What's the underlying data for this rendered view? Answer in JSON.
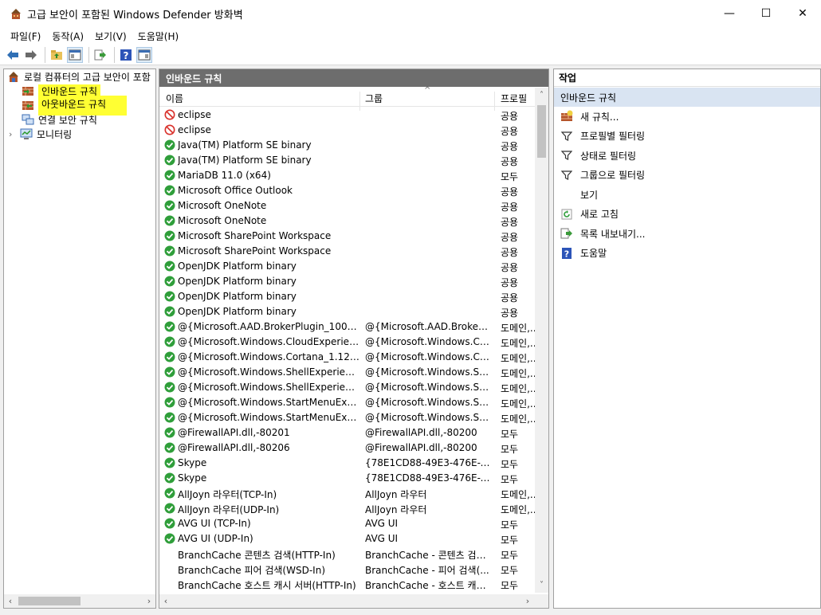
{
  "window": {
    "title": "고급 보안이 포함된 Windows Defender 방화벽",
    "minimize": "—",
    "maximize": "☐",
    "close": "✕"
  },
  "menu": [
    "파일(F)",
    "동작(A)",
    "보기(V)",
    "도움말(H)"
  ],
  "tree": {
    "root": "로컬 컴퓨터의 고급 보안이 포함",
    "items": [
      "인바운드 규칙",
      "아웃바운드 규칙",
      "연결 보안 규칙",
      "모니터링"
    ]
  },
  "center": {
    "title": "인바운드 규칙",
    "columns": {
      "name": "이름",
      "group": "그룹",
      "profile": "프로필"
    },
    "rows": [
      {
        "icon": "blocked",
        "name": "eclipse",
        "group": "",
        "profile": "공용"
      },
      {
        "icon": "blocked",
        "name": "eclipse",
        "group": "",
        "profile": "공용"
      },
      {
        "icon": "allowed",
        "name": "Java(TM) Platform SE binary",
        "group": "",
        "profile": "공용"
      },
      {
        "icon": "allowed",
        "name": "Java(TM) Platform SE binary",
        "group": "",
        "profile": "공용"
      },
      {
        "icon": "allowed",
        "name": "MariaDB 11.0 (x64)",
        "group": "",
        "profile": "모두"
      },
      {
        "icon": "allowed",
        "name": "Microsoft Office Outlook",
        "group": "",
        "profile": "공용"
      },
      {
        "icon": "allowed",
        "name": "Microsoft OneNote",
        "group": "",
        "profile": "공용"
      },
      {
        "icon": "allowed",
        "name": "Microsoft OneNote",
        "group": "",
        "profile": "공용"
      },
      {
        "icon": "allowed",
        "name": "Microsoft SharePoint Workspace",
        "group": "",
        "profile": "공용"
      },
      {
        "icon": "allowed",
        "name": "Microsoft SharePoint Workspace",
        "group": "",
        "profile": "공용"
      },
      {
        "icon": "allowed",
        "name": "OpenJDK Platform binary",
        "group": "",
        "profile": "공용"
      },
      {
        "icon": "allowed",
        "name": "OpenJDK Platform binary",
        "group": "",
        "profile": "공용"
      },
      {
        "icon": "allowed",
        "name": "OpenJDK Platform binary",
        "group": "",
        "profile": "공용"
      },
      {
        "icon": "allowed",
        "name": "OpenJDK Platform binary",
        "group": "",
        "profile": "공용"
      },
      {
        "icon": "allowed",
        "name": "@{Microsoft.AAD.BrokerPlugin_1000.18...",
        "group": "@{Microsoft.AAD.BrokerPlu...",
        "profile": "도메인,..."
      },
      {
        "icon": "allowed",
        "name": "@{Microsoft.Windows.CloudExperience...",
        "group": "@{Microsoft.Windows.Clou...",
        "profile": "도메인,..."
      },
      {
        "icon": "allowed",
        "name": "@{Microsoft.Windows.Cortana_1.12.3.1...",
        "group": "@{Microsoft.Windows.Cort...",
        "profile": "도메인,..."
      },
      {
        "icon": "allowed",
        "name": "@{Microsoft.Windows.ShellExperienceH...",
        "group": "@{Microsoft.Windows.Shell...",
        "profile": "도메인,..."
      },
      {
        "icon": "allowed",
        "name": "@{Microsoft.Windows.ShellExperienceH...",
        "group": "@{Microsoft.Windows.Shell...",
        "profile": "도메인,..."
      },
      {
        "icon": "allowed",
        "name": "@{Microsoft.Windows.StartMenuExperie...",
        "group": "@{Microsoft.Windows.Start...",
        "profile": "도메인,..."
      },
      {
        "icon": "allowed",
        "name": "@{Microsoft.Windows.StartMenuExperie...",
        "group": "@{Microsoft.Windows.Start...",
        "profile": "도메인,..."
      },
      {
        "icon": "allowed",
        "name": "@FirewallAPI.dll,-80201",
        "group": "@FirewallAPI.dll,-80200",
        "profile": "모두"
      },
      {
        "icon": "allowed",
        "name": "@FirewallAPI.dll,-80206",
        "group": "@FirewallAPI.dll,-80200",
        "profile": "모두"
      },
      {
        "icon": "allowed",
        "name": "Skype",
        "group": "{78E1CD88-49E3-476E-B9...",
        "profile": "모두"
      },
      {
        "icon": "allowed",
        "name": "Skype",
        "group": "{78E1CD88-49E3-476E-B9...",
        "profile": "모두"
      },
      {
        "icon": "allowed",
        "name": "AllJoyn 라우터(TCP-In)",
        "group": "AllJoyn 라우터",
        "profile": "도메인,..."
      },
      {
        "icon": "allowed",
        "name": "AllJoyn 라우터(UDP-In)",
        "group": "AllJoyn 라우터",
        "profile": "도메인,..."
      },
      {
        "icon": "allowed",
        "name": "AVG UI (TCP-In)",
        "group": "AVG UI",
        "profile": "모두"
      },
      {
        "icon": "allowed",
        "name": "AVG UI (UDP-In)",
        "group": "AVG UI",
        "profile": "모두"
      },
      {
        "icon": "none",
        "name": "BranchCache 콘텐츠 검색(HTTP-In)",
        "group": "BranchCache - 콘텐츠 검색...",
        "profile": "모두"
      },
      {
        "icon": "none",
        "name": "BranchCache 피어 검색(WSD-In)",
        "group": "BranchCache - 피어 검색(...",
        "profile": "모두"
      },
      {
        "icon": "none",
        "name": "BranchCache 호스트 캐시 서버(HTTP-In)",
        "group": "BranchCache - 호스트 캐시...",
        "profile": "모두"
      }
    ]
  },
  "actions": {
    "header": "작업",
    "section": "인바운드 규칙",
    "items": [
      {
        "icon": "new-rule-icon",
        "label": "새 규칙..."
      },
      {
        "icon": "filter-icon",
        "label": "프로필별 필터링"
      },
      {
        "icon": "filter-icon",
        "label": "상태로 필터링"
      },
      {
        "icon": "filter-icon",
        "label": "그룹으로 필터링"
      },
      {
        "icon": "",
        "label": "보기"
      },
      {
        "icon": "refresh-icon",
        "label": "새로 고침"
      },
      {
        "icon": "export-icon",
        "label": "목록 내보내기..."
      },
      {
        "icon": "help-icon",
        "label": "도움말"
      }
    ]
  }
}
